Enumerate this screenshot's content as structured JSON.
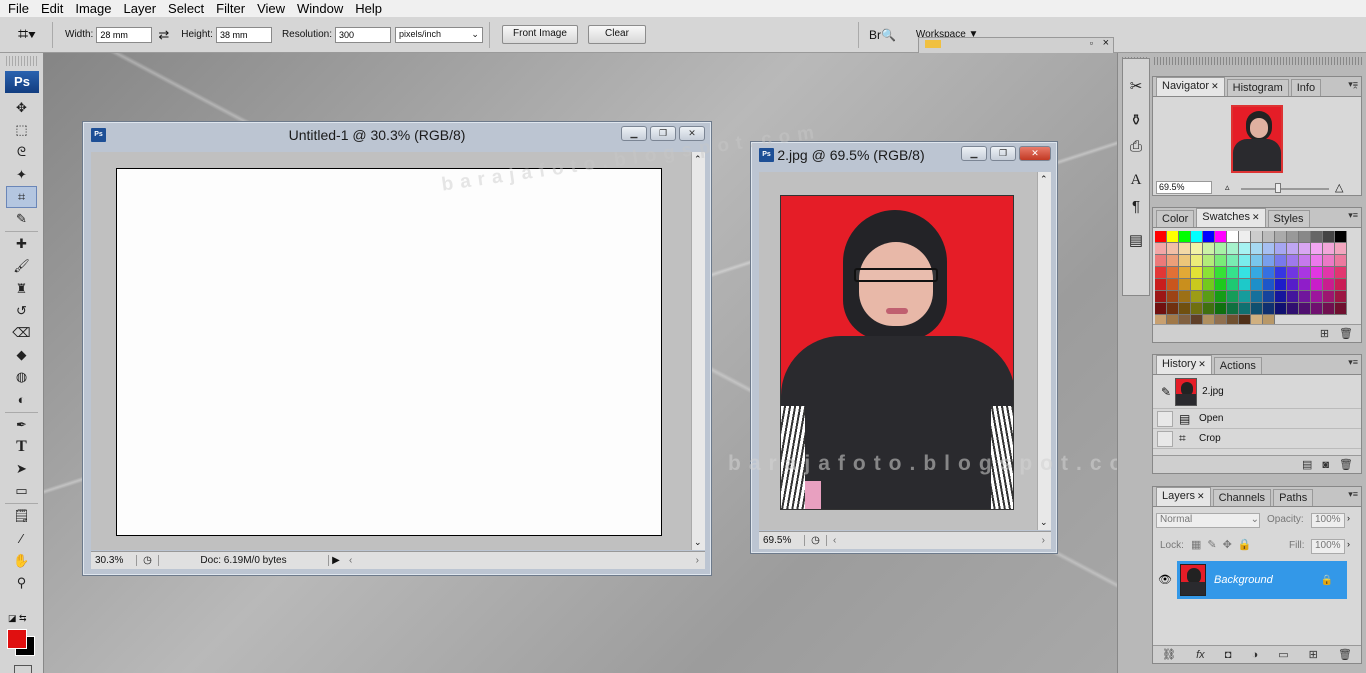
{
  "menubar": [
    "File",
    "Edit",
    "Image",
    "Layer",
    "Select",
    "Filter",
    "View",
    "Window",
    "Help"
  ],
  "options": {
    "width_label": "Width:",
    "width_value": "28 mm",
    "height_label": "Height:",
    "height_value": "38 mm",
    "resolution_label": "Resolution:",
    "resolution_value": "300",
    "unit_value": "pixels/inch",
    "front_image": "Front Image",
    "clear": "Clear",
    "workspace": "Workspace"
  },
  "doc1": {
    "title": "Untitled-1 @ 30.3% (RGB/8)",
    "zoom": "30.3%",
    "doc_info": "Doc: 6.19M/0 bytes"
  },
  "doc2": {
    "title": "2.jpg @ 69.5% (RGB/8)",
    "zoom": "69.5%"
  },
  "watermark": {
    "text1": "barajafoto.blogspot.com",
    "text2": "barajafoto.blogspot.com",
    "text3": "om"
  },
  "navigator": {
    "tabs": [
      "Navigator",
      "Histogram",
      "Info"
    ],
    "zoom": "69.5%"
  },
  "color_panel": {
    "tabs": [
      "Color",
      "Swatches",
      "Styles"
    ]
  },
  "history": {
    "tabs": [
      "History",
      "Actions"
    ],
    "snapshot": "2.jpg",
    "items": [
      "Open",
      "Crop"
    ]
  },
  "layers": {
    "tabs": [
      "Layers",
      "Channels",
      "Paths"
    ],
    "blend_mode": "Normal",
    "opacity_label": "Opacity:",
    "opacity": "100%",
    "lock_label": "Lock:",
    "fill_label": "Fill:",
    "fill": "100%",
    "layer_name": "Background"
  },
  "colors": {
    "foreground": "#e01010",
    "background": "#000000",
    "accent": "#3398e8",
    "photo_bg": "#e51d27"
  }
}
